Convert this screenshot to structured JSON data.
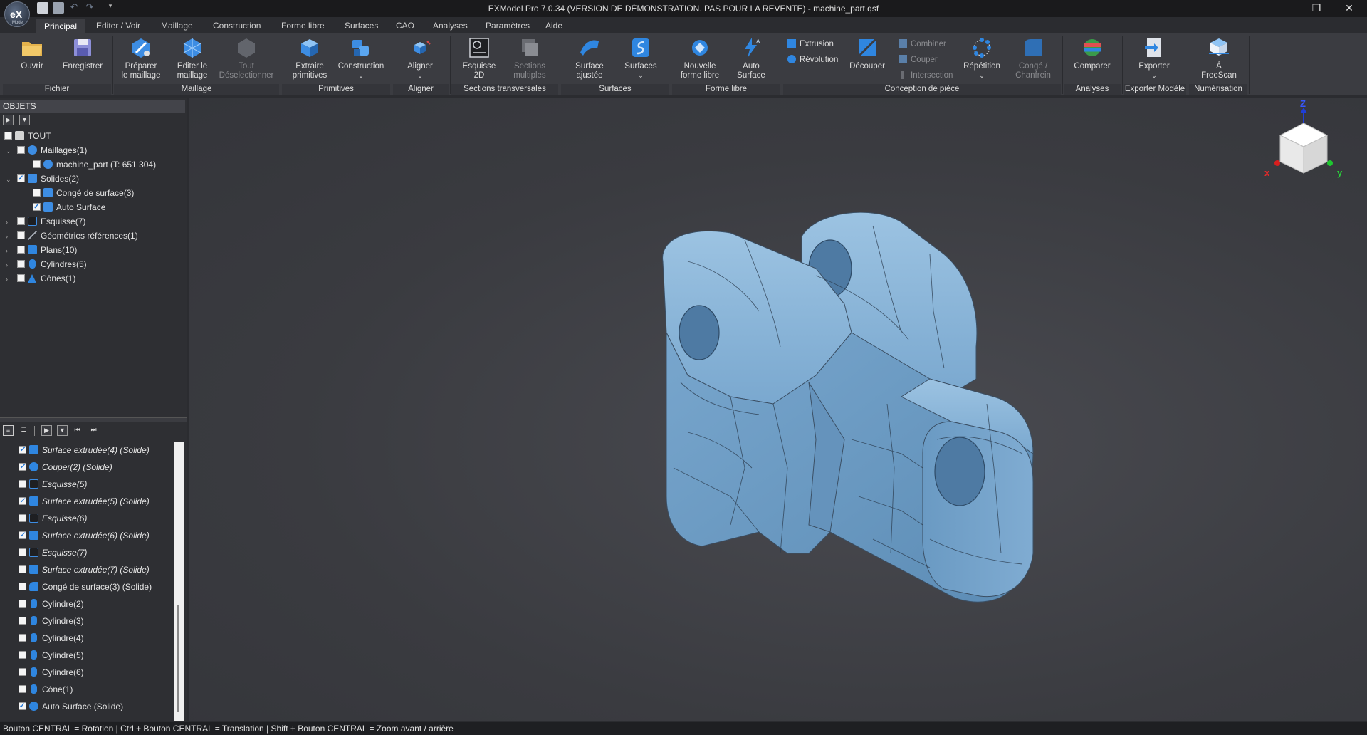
{
  "window": {
    "title": "EXModel Pro 7.0.34 (VERSION DE DÉMONSTRATION. PAS POUR LA REVENTE) - machine_part.qsf",
    "logo_text": "eX",
    "logo_sub": "Model",
    "minimize": "—",
    "restore": "❐",
    "close": "✕"
  },
  "menu": {
    "tabs": [
      "Principal",
      "Editer / Voir",
      "Maillage",
      "Construction",
      "Forme libre",
      "Surfaces",
      "CAO",
      "Analyses",
      "Paramètres",
      "Aide"
    ],
    "active": "Principal"
  },
  "ribbon": {
    "fichier": {
      "label": "Fichier",
      "open": "Ouvrir",
      "save": "Enregistrer"
    },
    "maillage": {
      "label": "Maillage",
      "prepare": [
        "Préparer",
        "le maillage"
      ],
      "edit": [
        "Editer le",
        "maillage"
      ],
      "deselect": [
        "Tout",
        "Déselectionner"
      ]
    },
    "primitives": {
      "label": "Primitives",
      "extract": [
        "Extraire",
        "primitives"
      ],
      "construction": "Construction"
    },
    "aligner": {
      "label": "Aligner",
      "align": "Aligner"
    },
    "sections": {
      "label": "Sections transversales",
      "sketch2d": [
        "Esquisse",
        "2D"
      ],
      "multi": [
        "Sections",
        "multiples"
      ]
    },
    "surfaces": {
      "label": "Surfaces",
      "fitted": [
        "Surface",
        "ajustée"
      ],
      "surfaces": "Surfaces"
    },
    "freeform": {
      "label": "Forme libre",
      "new": [
        "Nouvelle",
        "forme libre"
      ],
      "auto": [
        "Auto",
        "Surface"
      ]
    },
    "design": {
      "label": "Conception de pièce",
      "extrusion": "Extrusion",
      "revolution": "Révolution",
      "cut": "Découper",
      "combine": "Combiner",
      "couper": "Couper",
      "intersection": "Intersection",
      "repeat": "Répétition",
      "fillet": [
        "Congé /",
        "Chanfrein"
      ]
    },
    "analyses": {
      "label": "Analyses",
      "compare": "Comparer"
    },
    "export": {
      "label": "Exporter Modèle",
      "export": "Exporter"
    },
    "scan": {
      "label": "Numérisation",
      "freescan": [
        "À",
        "FreeScan"
      ]
    }
  },
  "objects_panel": {
    "header": "OBJETS",
    "rows": [
      {
        "label": "TOUT",
        "checked": false,
        "icon": "list-icon",
        "arrow": ""
      },
      {
        "label": "Maillages(1)",
        "checked": false,
        "icon": "mesh-icon",
        "arrow": "⌄"
      },
      {
        "label": "machine_part (T: 651 304)",
        "checked": false,
        "icon": "mesh-icon",
        "arrow": ""
      },
      {
        "label": "Solides(2)",
        "checked": true,
        "icon": "solid-icon",
        "arrow": "⌄"
      },
      {
        "label": "Congé de surface(3)",
        "checked": false,
        "icon": "solid-icon",
        "arrow": ""
      },
      {
        "label": "Auto Surface",
        "checked": true,
        "icon": "solid-icon",
        "arrow": ""
      },
      {
        "label": "Esquisse(7)",
        "checked": false,
        "icon": "sketch-icon",
        "arrow": "›"
      },
      {
        "label": "Géométries références(1)",
        "checked": false,
        "icon": "reference-icon",
        "arrow": "›"
      },
      {
        "label": "Plans(10)",
        "checked": false,
        "icon": "plane-icon",
        "arrow": "›"
      },
      {
        "label": "Cylindres(5)",
        "checked": false,
        "icon": "cylinder-icon",
        "arrow": "›"
      },
      {
        "label": "Cônes(1)",
        "checked": false,
        "icon": "cone-icon",
        "arrow": "›"
      }
    ]
  },
  "history_panel": {
    "rows": [
      {
        "label": "Surface extrudée(4) (Solide)",
        "checked": true,
        "italic": true,
        "icon": "extrude-icon"
      },
      {
        "label": "Couper(2) (Solide)",
        "checked": true,
        "italic": true,
        "icon": "cut-icon"
      },
      {
        "label": "Esquisse(5)",
        "checked": false,
        "italic": true,
        "icon": "sketch-icon"
      },
      {
        "label": "Surface extrudée(5) (Solide)",
        "checked": true,
        "italic": true,
        "icon": "extrude-icon"
      },
      {
        "label": "Esquisse(6)",
        "checked": false,
        "italic": true,
        "icon": "sketch-icon"
      },
      {
        "label": "Surface extrudée(6) (Solide)",
        "checked": true,
        "italic": true,
        "icon": "extrude-icon"
      },
      {
        "label": "Esquisse(7)",
        "checked": false,
        "italic": true,
        "icon": "sketch-icon"
      },
      {
        "label": "Surface extrudée(7) (Solide)",
        "checked": false,
        "italic": true,
        "icon": "extrude-icon"
      },
      {
        "label": "Congé de surface(3) (Solide)",
        "checked": false,
        "italic": false,
        "icon": "fillet-icon"
      },
      {
        "label": "Cylindre(2)",
        "checked": false,
        "italic": false,
        "icon": "cylinder-icon"
      },
      {
        "label": "Cylindre(3)",
        "checked": false,
        "italic": false,
        "icon": "cylinder-icon"
      },
      {
        "label": "Cylindre(4)",
        "checked": false,
        "italic": false,
        "icon": "cylinder-icon"
      },
      {
        "label": "Cylindre(5)",
        "checked": false,
        "italic": false,
        "icon": "cylinder-icon"
      },
      {
        "label": "Cylindre(6)",
        "checked": false,
        "italic": false,
        "icon": "cylinder-icon"
      },
      {
        "label": "Cône(1)",
        "checked": false,
        "italic": false,
        "icon": "cone-icon"
      },
      {
        "label": "Auto Surface (Solide)",
        "checked": true,
        "italic": false,
        "icon": "auto-surface-icon"
      }
    ]
  },
  "viewcube": {
    "z": "Z",
    "x": "x",
    "y": "y"
  },
  "statusbar": {
    "text": "Bouton CENTRAL = Rotation | Ctrl + Bouton CENTRAL = Translation | Shift + Bouton CENTRAL = Zoom avant / arrière"
  },
  "colors": {
    "accent": "#2f86e0",
    "model": "#6f9fc8",
    "background": "#2b2c30"
  }
}
